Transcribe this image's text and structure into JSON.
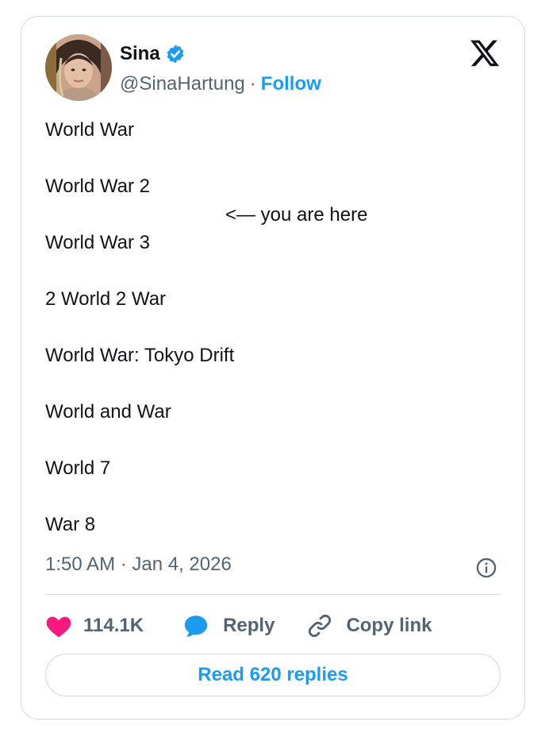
{
  "author": {
    "name": "Sina",
    "handle": "@SinaHartung",
    "separator": "·",
    "follow_label": "Follow"
  },
  "tweet": {
    "lines": [
      "World War",
      "World War 2",
      "<— you are here",
      "World War 3",
      "2 World 2 War",
      "World War: Tokyo Drift",
      "World and War",
      "World 7",
      "War 8"
    ],
    "timestamp": "1:50 AM · Jan 4, 2026"
  },
  "actions": {
    "likes_count": "114.1K",
    "reply_label": "Reply",
    "copy_link_label": "Copy link",
    "read_replies_label": "Read 620 replies"
  },
  "icons": {
    "verified": "verified-badge-icon",
    "x_logo": "x-logo-icon",
    "info": "info-icon",
    "like": "heart-icon",
    "reply": "reply-bubble-icon",
    "copy": "link-icon"
  },
  "colors": {
    "accent": "#1d9bf0",
    "like": "#f91880",
    "text": "#0f1419",
    "secondary": "#536471",
    "border": "#cfd9de"
  }
}
